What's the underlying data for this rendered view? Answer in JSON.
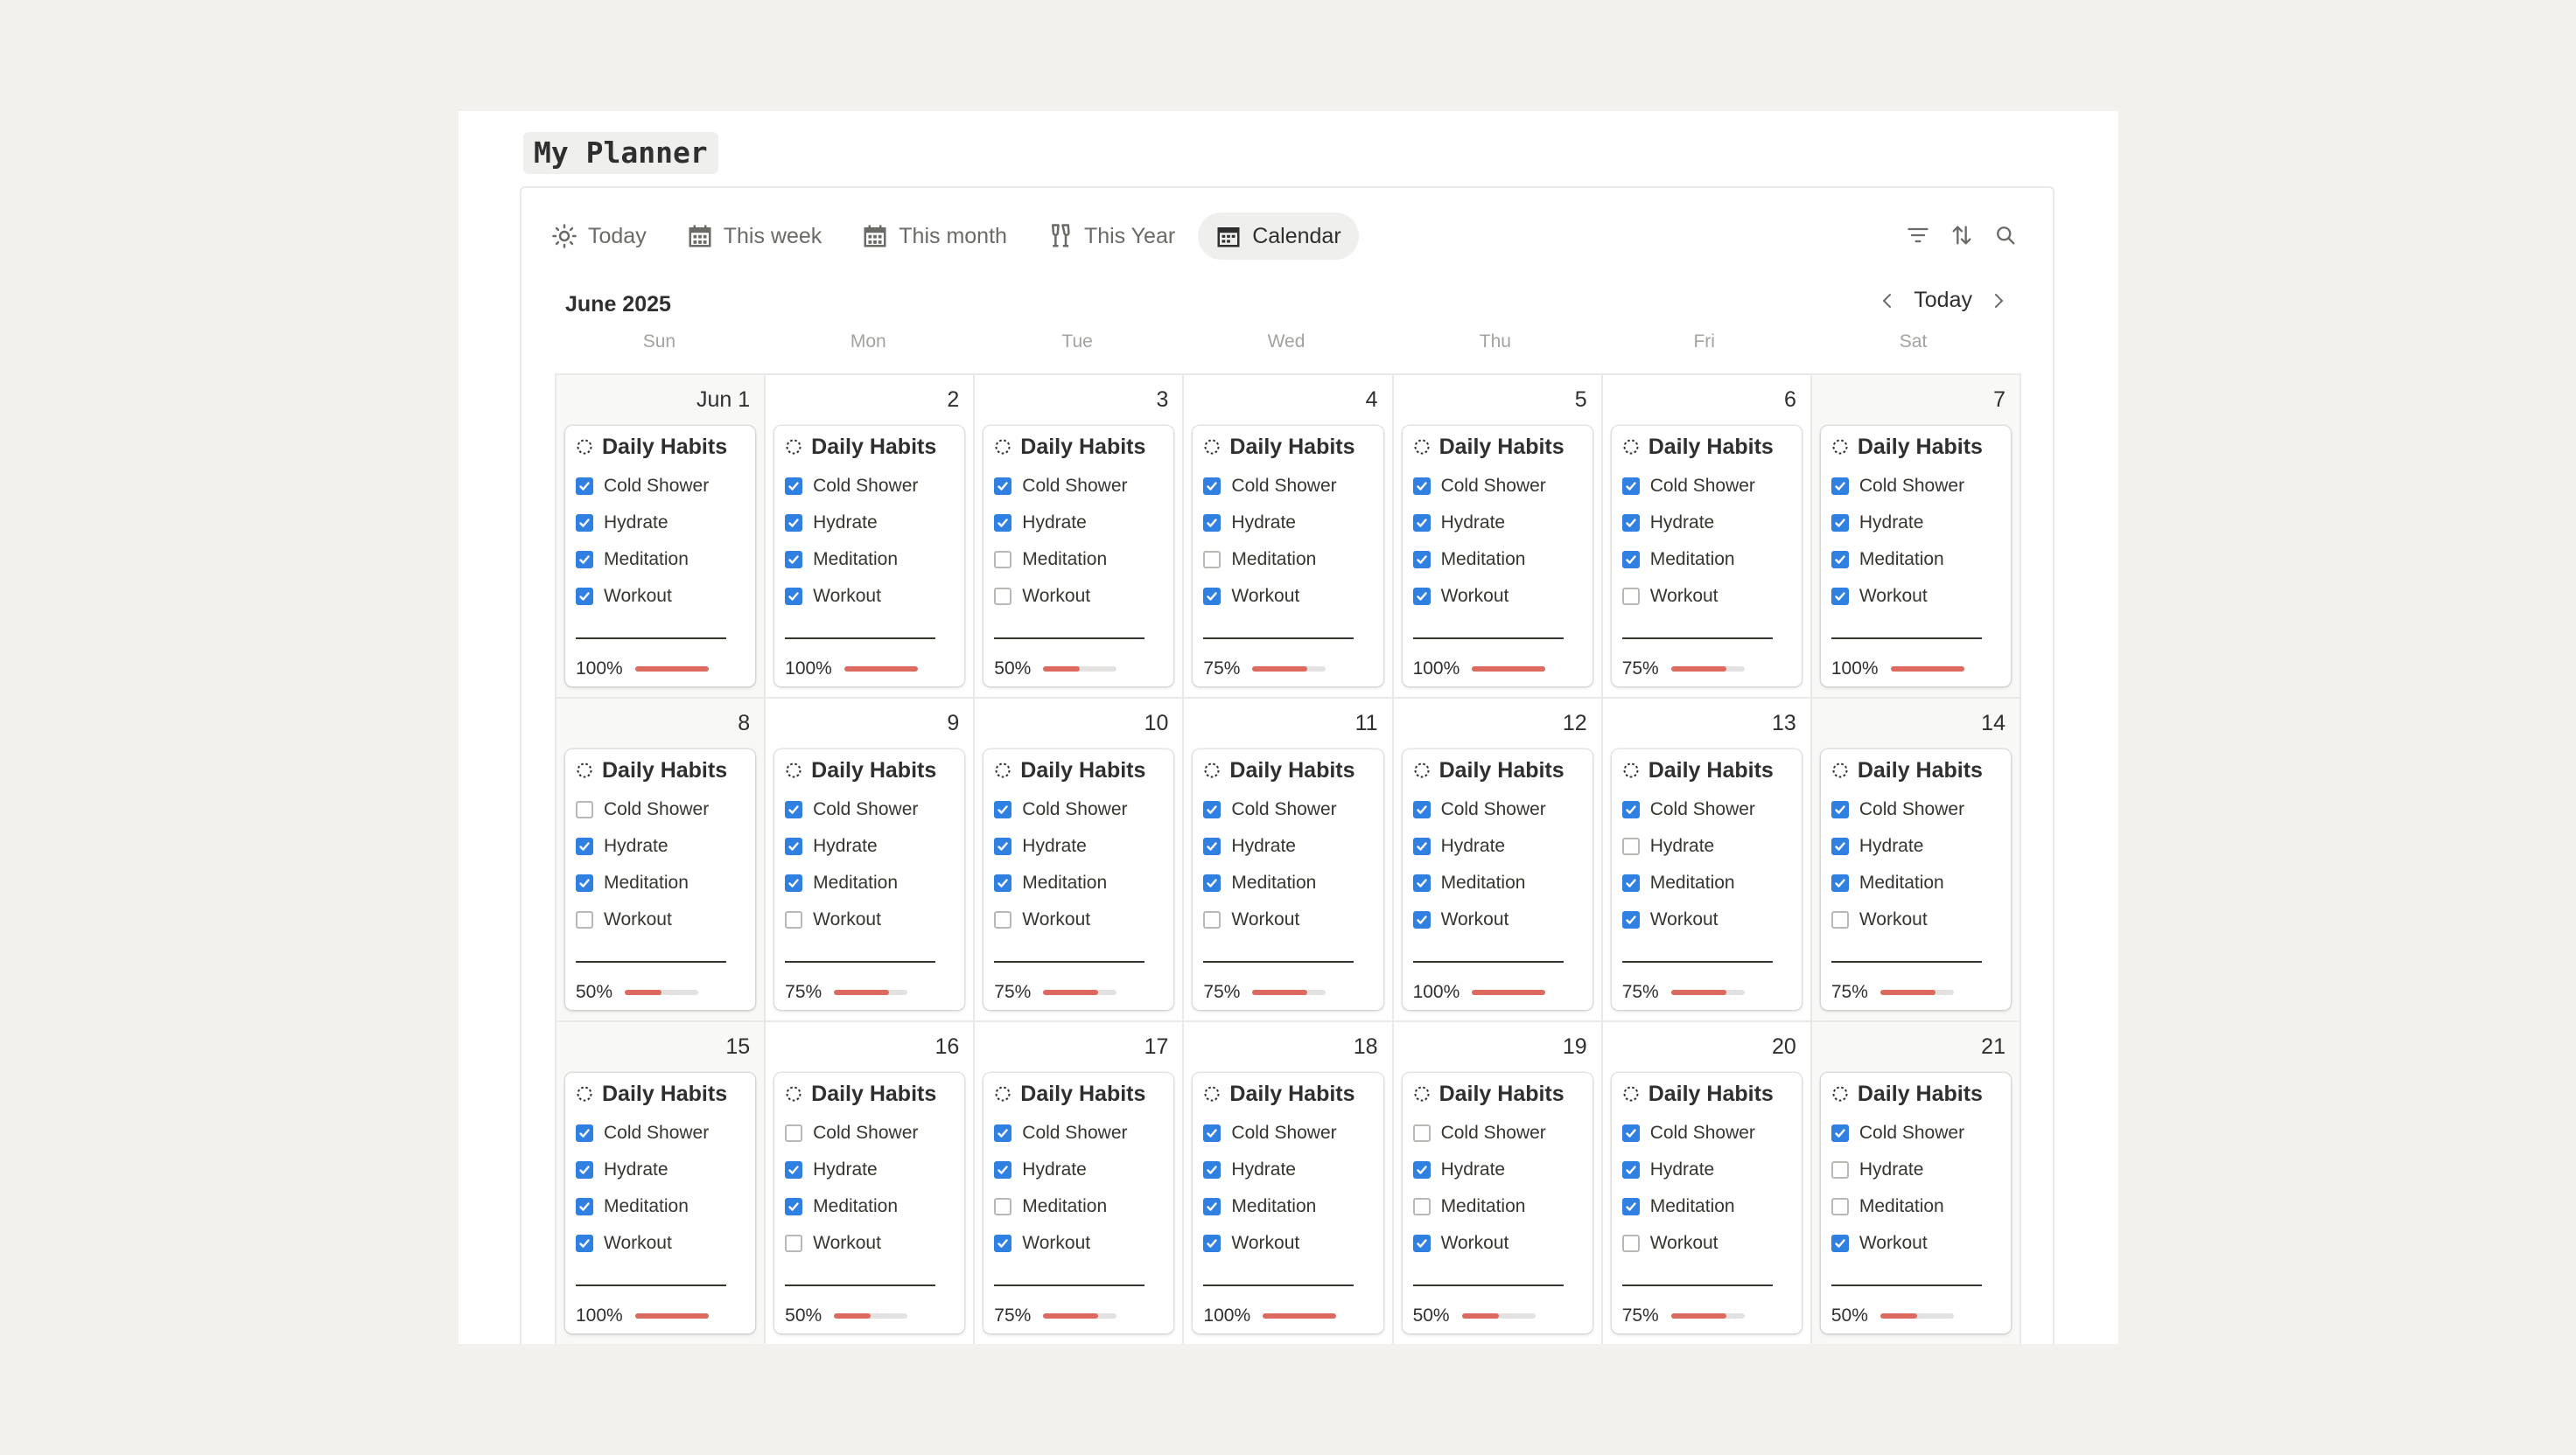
{
  "page": {
    "title": "My Planner"
  },
  "tabs": [
    {
      "label": "Today",
      "icon": "sun-icon",
      "active": false
    },
    {
      "label": "This week",
      "icon": "calendar-icon",
      "active": false
    },
    {
      "label": "This month",
      "icon": "calendar-icon",
      "active": false
    },
    {
      "label": "This Year",
      "icon": "champagne-icon",
      "active": false
    },
    {
      "label": "Calendar",
      "icon": "calendar-icon",
      "active": true
    }
  ],
  "toolbar": {
    "icons": [
      "filter-icon",
      "sort-icon",
      "search-icon"
    ]
  },
  "calendar": {
    "month_label": "June 2025",
    "today_label": "Today",
    "weekdays": [
      "Sun",
      "Mon",
      "Tue",
      "Wed",
      "Thu",
      "Fri",
      "Sat"
    ],
    "card_title": "Daily Habits",
    "habit_names": [
      "Cold Shower",
      "Hydrate",
      "Meditation",
      "Workout"
    ],
    "days": [
      {
        "label": "Jun 1",
        "checks": [
          1,
          1,
          1,
          1
        ],
        "pct": "100%",
        "progress": 1.0
      },
      {
        "label": "2",
        "checks": [
          1,
          1,
          1,
          1
        ],
        "pct": "100%",
        "progress": 1.0
      },
      {
        "label": "3",
        "checks": [
          1,
          1,
          0,
          0
        ],
        "pct": "50%",
        "progress": 0.5
      },
      {
        "label": "4",
        "checks": [
          1,
          1,
          0,
          1
        ],
        "pct": "75%",
        "progress": 0.75
      },
      {
        "label": "5",
        "checks": [
          1,
          1,
          1,
          1
        ],
        "pct": "100%",
        "progress": 1.0
      },
      {
        "label": "6",
        "checks": [
          1,
          1,
          1,
          0
        ],
        "pct": "75%",
        "progress": 0.75
      },
      {
        "label": "7",
        "checks": [
          1,
          1,
          1,
          1
        ],
        "pct": "100%",
        "progress": 1.0
      },
      {
        "label": "8",
        "checks": [
          0,
          1,
          1,
          0
        ],
        "pct": "50%",
        "progress": 0.5
      },
      {
        "label": "9",
        "checks": [
          1,
          1,
          1,
          0
        ],
        "pct": "75%",
        "progress": 0.75
      },
      {
        "label": "10",
        "checks": [
          1,
          1,
          1,
          0
        ],
        "pct": "75%",
        "progress": 0.75
      },
      {
        "label": "11",
        "checks": [
          1,
          1,
          1,
          0
        ],
        "pct": "75%",
        "progress": 0.75
      },
      {
        "label": "12",
        "checks": [
          1,
          1,
          1,
          1
        ],
        "pct": "100%",
        "progress": 1.0
      },
      {
        "label": "13",
        "checks": [
          1,
          0,
          1,
          1
        ],
        "pct": "75%",
        "progress": 0.75
      },
      {
        "label": "14",
        "checks": [
          1,
          1,
          1,
          0
        ],
        "pct": "75%",
        "progress": 0.75
      },
      {
        "label": "15",
        "checks": [
          1,
          1,
          1,
          1
        ],
        "pct": "100%",
        "progress": 1.0
      },
      {
        "label": "16",
        "checks": [
          0,
          1,
          1,
          0
        ],
        "pct": "50%",
        "progress": 0.5
      },
      {
        "label": "17",
        "checks": [
          1,
          1,
          0,
          1
        ],
        "pct": "75%",
        "progress": 0.75
      },
      {
        "label": "18",
        "checks": [
          1,
          1,
          1,
          1
        ],
        "pct": "100%",
        "progress": 1.0
      },
      {
        "label": "19",
        "checks": [
          0,
          1,
          0,
          1
        ],
        "pct": "50%",
        "progress": 0.5
      },
      {
        "label": "20",
        "checks": [
          1,
          1,
          1,
          0
        ],
        "pct": "75%",
        "progress": 0.75
      },
      {
        "label": "21",
        "checks": [
          1,
          0,
          0,
          1
        ],
        "pct": "50%",
        "progress": 0.5
      }
    ]
  },
  "colors": {
    "checkbox_checked": "#2f80e0",
    "progress_fill": "#dc6a5f",
    "progress_track": "#e3e2e0",
    "background": "#f2f1ee"
  }
}
